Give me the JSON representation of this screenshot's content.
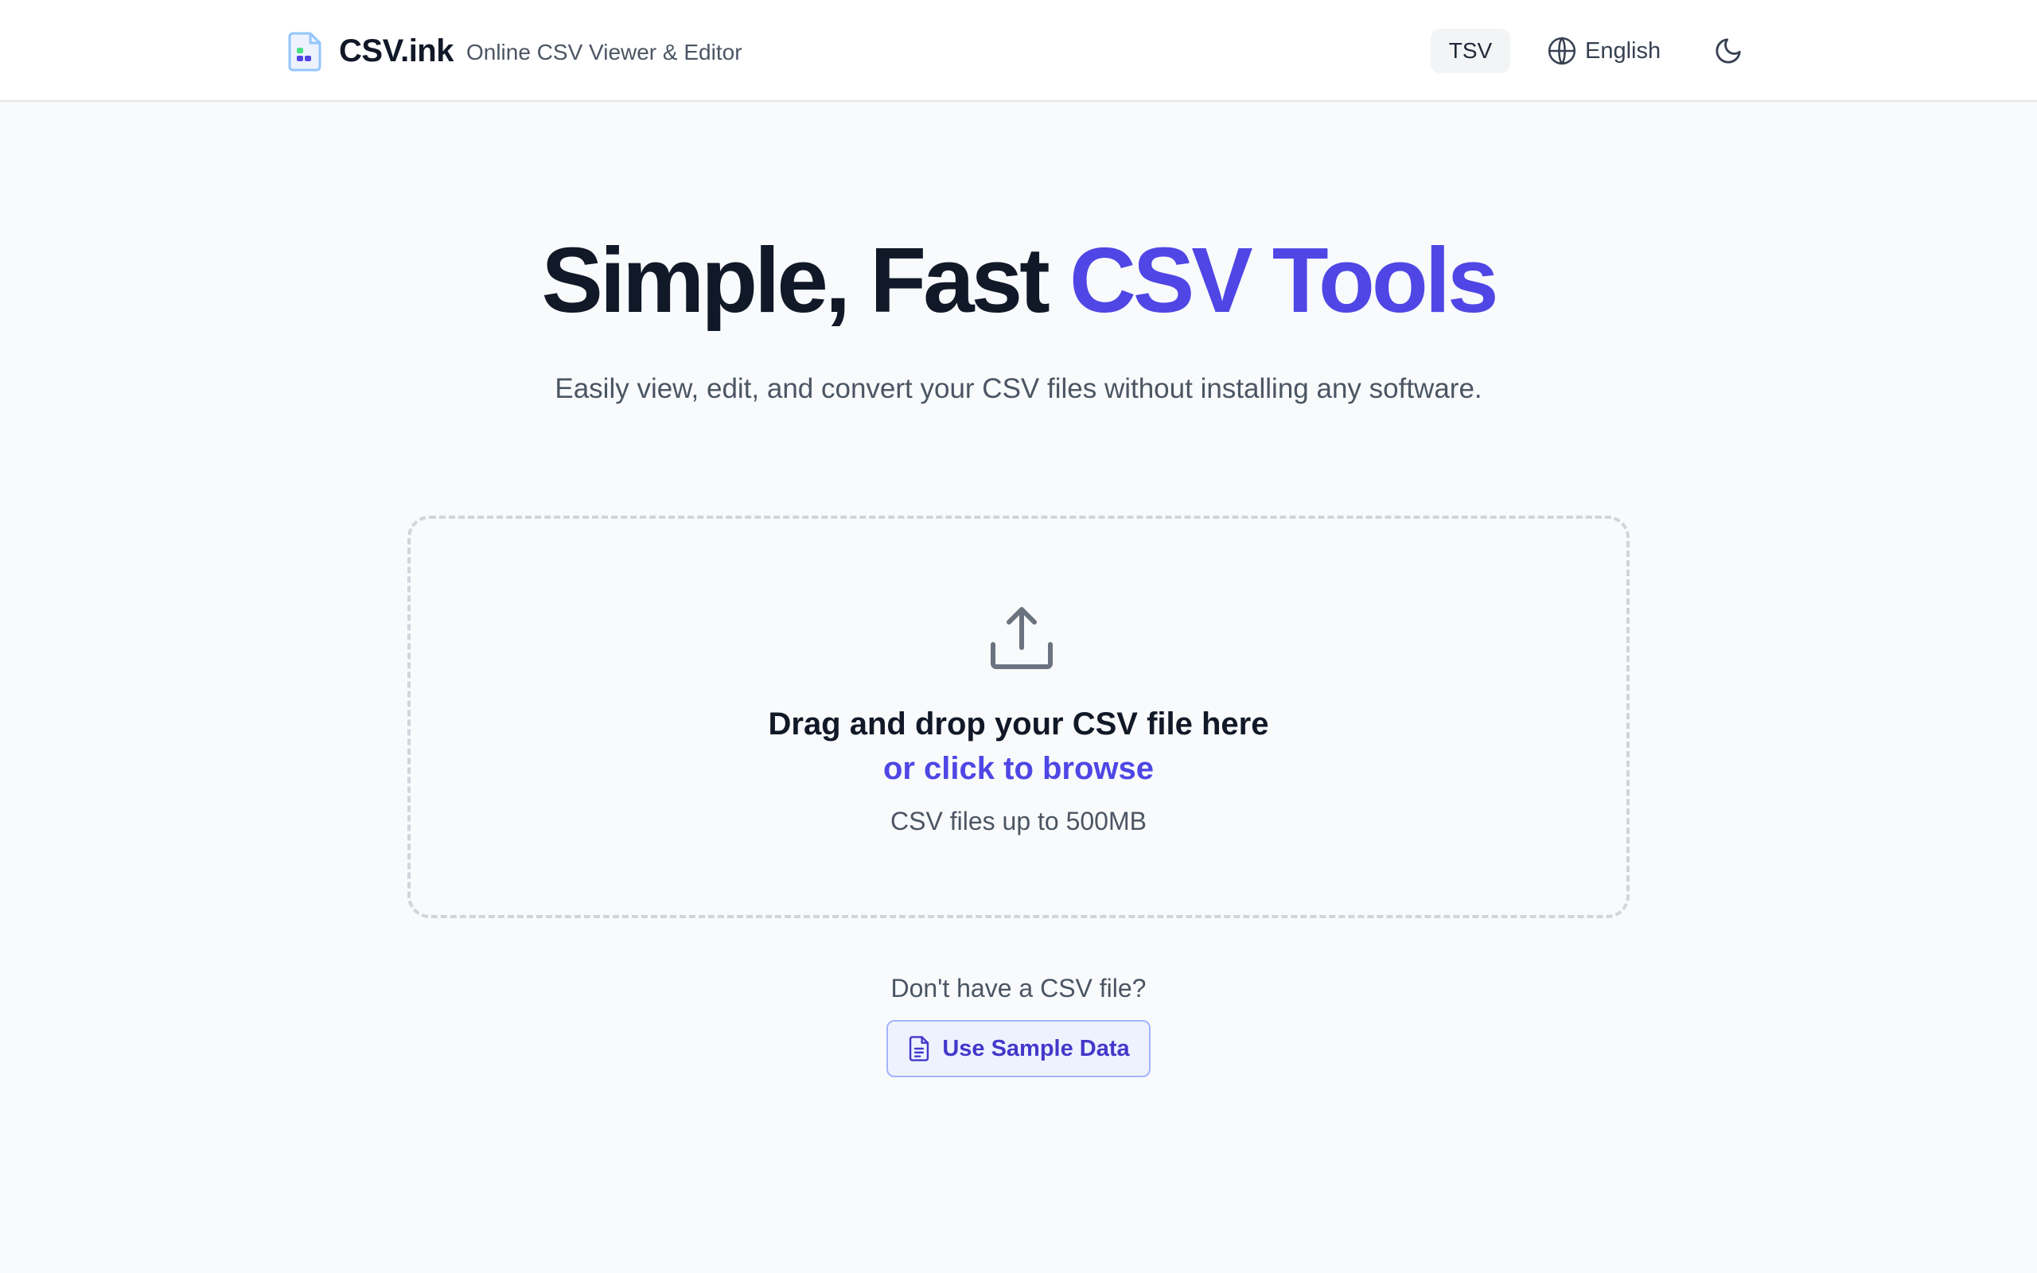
{
  "header": {
    "brand_name": "CSV.ink",
    "tagline": "Online CSV Viewer & Editor",
    "tsv_label": "TSV",
    "language_label": "English",
    "icons": {
      "logo": "csv-file-logo-icon",
      "language": "globe-icon",
      "theme": "moon-icon"
    }
  },
  "hero": {
    "title_plain": "Simple, Fast ",
    "title_accent": "CSV Tools",
    "subtitle": "Easily view, edit, and convert your CSV files without installing any software."
  },
  "dropzone": {
    "title": "Drag and drop your CSV file here",
    "browse": "or click to browse",
    "limit": "CSV files up to 500MB",
    "icon": "upload-icon"
  },
  "sample": {
    "prompt": "Don't have a CSV file?",
    "button_label": "Use Sample Data",
    "icon": "document-icon"
  },
  "colors": {
    "accent": "#4f46e5",
    "background": "#f8fafc",
    "text": "#111827",
    "muted": "#4b5563"
  }
}
